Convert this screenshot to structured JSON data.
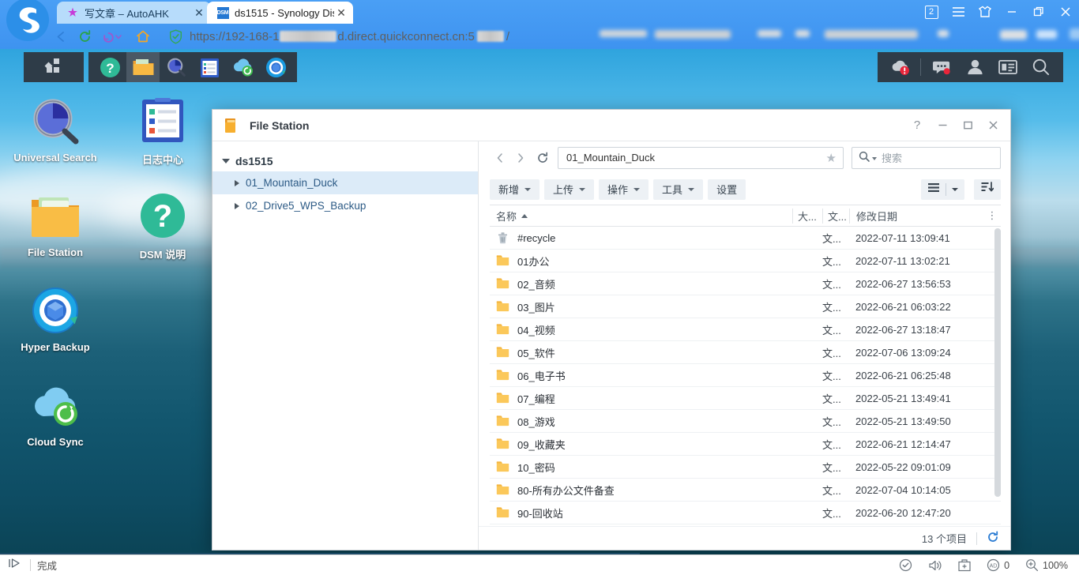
{
  "browser": {
    "logo_icon": "browser-logo-s",
    "tabs": [
      {
        "title": "写文章 – AutoAHK",
        "favicon": "autoahk-star-icon",
        "active": false,
        "close_label": "✕"
      },
      {
        "title": "ds1515 - Synology Dis",
        "favicon": "dsm-icon",
        "favicon_text": "DSM",
        "active": true,
        "close_label": "✕"
      }
    ],
    "window_controls": {
      "tab_count_badge": "2",
      "menu_icon": "hamburger-menu-icon",
      "skin_icon": "theme-shirt-icon",
      "minimize_label": "—",
      "restore_label": "❐",
      "close_label": "✕"
    },
    "nav": {
      "back_icon": "back-arrow-icon",
      "reload_icon": "reload-icon",
      "history_icon": "history-back-icon",
      "home_icon": "home-icon"
    },
    "address": {
      "security_icon": "shield-secure-icon",
      "url_prefix": "https://192-168-1",
      "url_mid": "d.direct.quickconnect.cn:5",
      "url_suffix": "/",
      "redacted": true
    }
  },
  "dsm": {
    "taskbar": {
      "menu_icon": "dsm-main-menu-icon",
      "apps": [
        {
          "name": "dsm-help",
          "icon": "question-circle-icon",
          "active": false
        },
        {
          "name": "file-station",
          "icon": "folder-icon",
          "active": true
        },
        {
          "name": "universal-search",
          "icon": "magnifier-icon",
          "active": false
        },
        {
          "name": "log-center",
          "icon": "clipboard-icon",
          "active": false
        },
        {
          "name": "cloud-sync",
          "icon": "cloud-sync-icon",
          "active": false
        },
        {
          "name": "hyper-backup",
          "icon": "hyper-backup-icon",
          "active": false
        }
      ],
      "right_icons": [
        {
          "name": "notifications-cloud",
          "icon": "cloud-alert-icon",
          "badge": true
        },
        {
          "name": "chat",
          "icon": "chat-bubble-icon",
          "badge": true
        },
        {
          "name": "user-account",
          "icon": "person-icon",
          "badge": false
        },
        {
          "name": "widgets",
          "icon": "widgets-icon",
          "badge": false
        },
        {
          "name": "search",
          "icon": "search-icon",
          "badge": false
        }
      ]
    },
    "desktop_icons": [
      {
        "label": "Universal Search",
        "icon": "universal-search-icon"
      },
      {
        "label": "日志中心",
        "icon": "log-center-icon"
      },
      {
        "label": "File Station",
        "icon": "file-station-icon"
      },
      {
        "label": "DSM 说明",
        "icon": "dsm-help-icon"
      },
      {
        "label": "Hyper Backup",
        "icon": "hyper-backup-icon"
      },
      {
        "label": "Cloud Sync",
        "icon": "cloud-sync-icon"
      }
    ]
  },
  "file_station": {
    "title": "File Station",
    "title_icon": "folder-icon",
    "titlebar_buttons": {
      "help": "?",
      "minimize": "—",
      "maximize": "▢",
      "close": "✕"
    },
    "sidebar": {
      "root": {
        "label": "ds1515",
        "expanded": true
      },
      "items": [
        {
          "label": "01_Mountain_Duck",
          "selected": true
        },
        {
          "label": "02_Drive5_WPS_Backup",
          "selected": false
        }
      ]
    },
    "pathbar": {
      "back_icon": "chevron-left-icon",
      "forward_icon": "chevron-right-icon",
      "refresh_icon": "refresh-icon",
      "path_value": "01_Mountain_Duck",
      "favorite_icon": "star-icon",
      "search_icon": "search-icon",
      "search_placeholder": "搜索"
    },
    "toolbar": {
      "buttons": [
        {
          "label": "新增",
          "has_caret": true
        },
        {
          "label": "上传",
          "has_caret": true
        },
        {
          "label": "操作",
          "has_caret": true
        },
        {
          "label": "工具",
          "has_caret": true
        },
        {
          "label": "设置",
          "has_caret": false
        }
      ],
      "view_icon": "list-view-icon",
      "view_caret_icon": "chevron-down-icon",
      "sort_icon": "sort-descending-icon"
    },
    "columns": {
      "name": "名称",
      "size": "大...",
      "type": "文...",
      "date": "修改日期",
      "more_icon": "more-vertical-icon",
      "sort_column": "name",
      "sort_dir": "asc"
    },
    "rows": [
      {
        "name": "#recycle",
        "icon": "trash-icon",
        "size": "",
        "type": "文...",
        "date": "2022-07-11 13:09:41"
      },
      {
        "name": "01办公",
        "icon": "folder-icon",
        "size": "",
        "type": "文...",
        "date": "2022-07-11 13:02:21"
      },
      {
        "name": "02_音频",
        "icon": "folder-icon",
        "size": "",
        "type": "文...",
        "date": "2022-06-27 13:56:53"
      },
      {
        "name": "03_图片",
        "icon": "folder-icon",
        "size": "",
        "type": "文...",
        "date": "2022-06-21 06:03:22"
      },
      {
        "name": "04_视频",
        "icon": "folder-icon",
        "size": "",
        "type": "文...",
        "date": "2022-06-27 13:18:47"
      },
      {
        "name": "05_软件",
        "icon": "folder-icon",
        "size": "",
        "type": "文...",
        "date": "2022-07-06 13:09:24"
      },
      {
        "name": "06_电子书",
        "icon": "folder-icon",
        "size": "",
        "type": "文...",
        "date": "2022-06-21 06:25:48"
      },
      {
        "name": "07_编程",
        "icon": "folder-icon",
        "size": "",
        "type": "文...",
        "date": "2022-05-21 13:49:41"
      },
      {
        "name": "08_游戏",
        "icon": "folder-icon",
        "size": "",
        "type": "文...",
        "date": "2022-05-21 13:49:50"
      },
      {
        "name": "09_收藏夹",
        "icon": "folder-icon",
        "size": "",
        "type": "文...",
        "date": "2022-06-21 12:14:47"
      },
      {
        "name": "10_密码",
        "icon": "folder-icon",
        "size": "",
        "type": "文...",
        "date": "2022-05-22 09:01:09"
      },
      {
        "name": "80-所有办公文件备查",
        "icon": "folder-icon",
        "size": "",
        "type": "文...",
        "date": "2022-07-04 10:14:05"
      },
      {
        "name": "90-回收站",
        "icon": "folder-icon",
        "size": "",
        "type": "文...",
        "date": "2022-06-20 12:47:20"
      }
    ],
    "status": {
      "item_count": "13 个项目",
      "refresh_icon": "refresh-icon"
    }
  },
  "os_taskbar": {
    "play_icon": "play-triangle-icon",
    "status_text": "完成",
    "right_items": [
      {
        "name": "shield-check-icon",
        "label": ""
      },
      {
        "name": "volume-icon",
        "label": ""
      },
      {
        "name": "toolbox-icon",
        "label": ""
      },
      {
        "name": "adblock-icon",
        "label": "0"
      },
      {
        "name": "zoom-icon",
        "label": "100%"
      }
    ]
  },
  "colors": {
    "browser_blue": "#3E9BF5",
    "dsm_taskbar": "#2E3C48",
    "dsm_taskbar_active": "#4A5865",
    "tree_selected": "#DCEBF8",
    "toolbar_button": "#EDF1F5",
    "link_blue": "#2c5a85",
    "folder_yellow": "#F5C242",
    "accent_green": "#28B68C"
  }
}
